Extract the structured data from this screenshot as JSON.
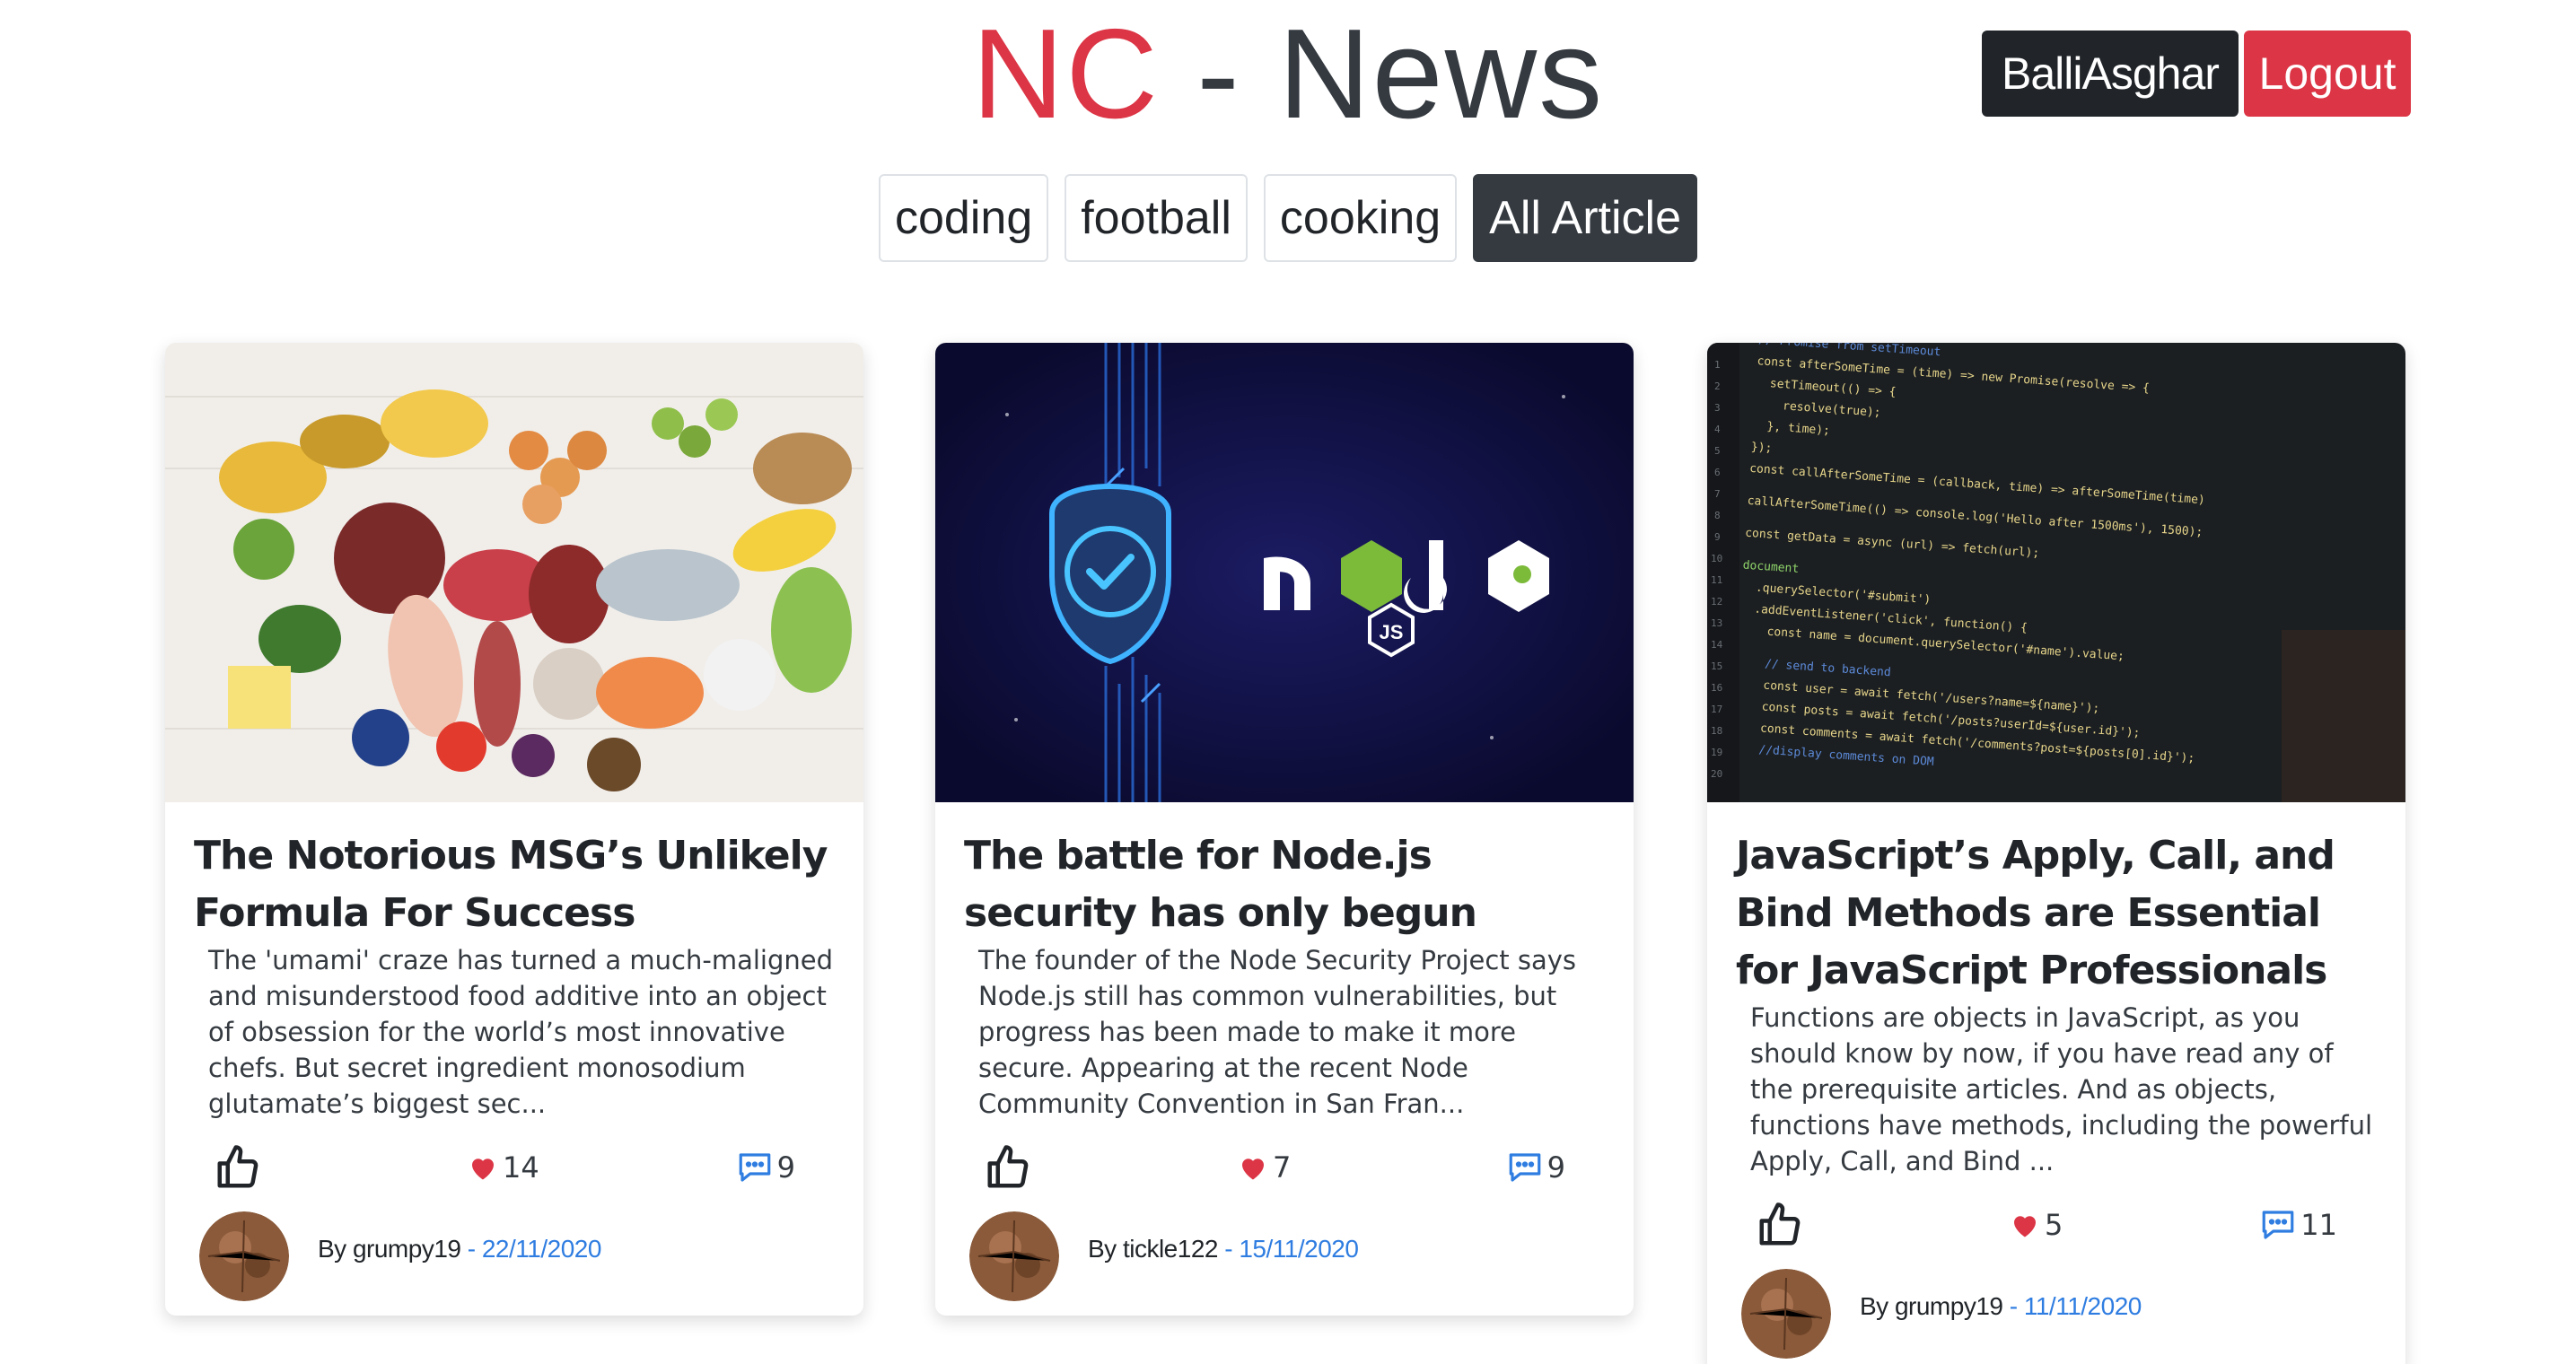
{
  "header": {
    "brand_nc": "NC",
    "brand_rest": " - News",
    "username": "BalliAsghar",
    "logout_label": "Logout"
  },
  "topics": [
    {
      "label": "coding",
      "active": false
    },
    {
      "label": "football",
      "active": false
    },
    {
      "label": "cooking",
      "active": false
    },
    {
      "label": "All Article",
      "active": true
    }
  ],
  "articles": [
    {
      "title": "The Notorious MSG’s Unlikely Formula For Success",
      "body": "The 'umami' craze has turned a much-maligned and misunderstood food additive into an object of obsession for the world’s most innovative chefs. But secret ingredient monosodium glutamate’s biggest sec...",
      "likes": "14",
      "comments": "9",
      "by": "By grumpy19",
      "date": " - 22/11/2020",
      "image": "food-ingredients-photo"
    },
    {
      "title": "The battle for Node.js security has only begun",
      "body": "The founder of the Node Security Project says Node.js still has common vulnerabilities, but progress has been made to make it more secure. Appearing at the recent Node Community Convention in San Fran...",
      "likes": "7",
      "comments": "9",
      "by": "By tickle122",
      "date": " - 15/11/2020",
      "image": "nodejs-security-shield"
    },
    {
      "title": "JavaScript’s Apply, Call, and Bind Methods are Essential for JavaScript Professionals",
      "body": "Functions are objects in JavaScript, as you should know by now, if you have read any of the prerequisite articles. And as objects, functions have methods, including the powerful Apply, Call, and Bind ...",
      "likes": "5",
      "comments": "11",
      "by": "By grumpy19",
      "date": " - 11/11/2020",
      "image": "code-editor-screen"
    }
  ],
  "colors": {
    "accent_red": "#dc3545",
    "dark": "#212529",
    "date_blue": "#2f7de1",
    "comment_blue": "#2f7de1"
  }
}
